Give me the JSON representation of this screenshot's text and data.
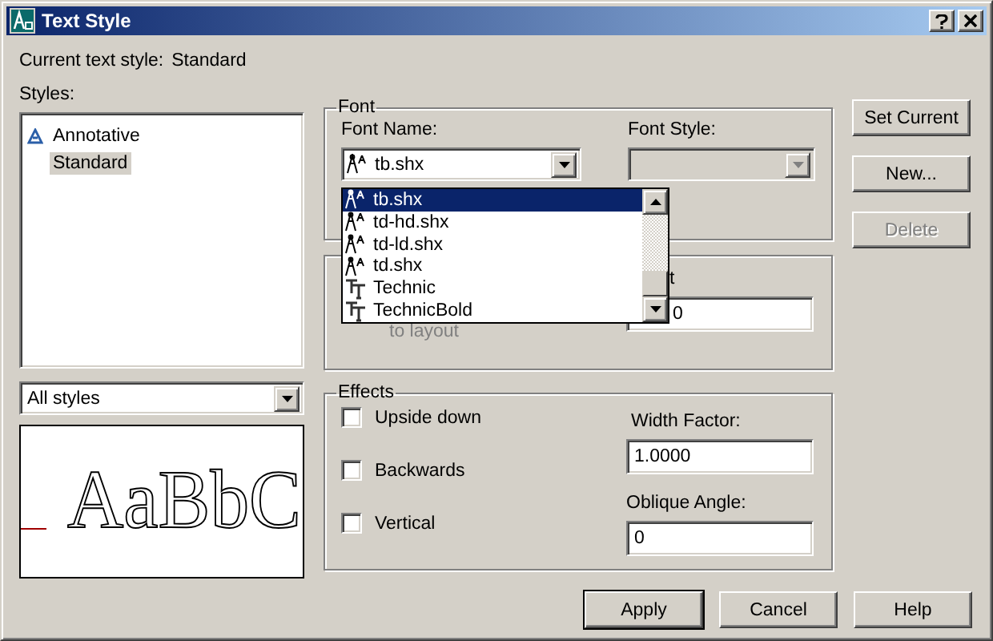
{
  "window": {
    "title": "Text Style"
  },
  "current_style": {
    "label": "Current text style:",
    "value": "Standard"
  },
  "styles": {
    "label": "Styles:",
    "items": [
      {
        "name": "Annotative",
        "annotative": true,
        "selected": false
      },
      {
        "name": "Standard",
        "annotative": false,
        "selected": true
      }
    ],
    "filter": "All styles"
  },
  "preview": {
    "sample": "AaBbC"
  },
  "font": {
    "legend": "Font",
    "font_name_label": "Font Name:",
    "font_name": "tb.shx",
    "font_style_label": "Font Style:",
    "font_style_disabled": true,
    "dropdown": [
      {
        "name": "tb.shx",
        "kind": "shx",
        "selected": true
      },
      {
        "name": "td-hd.shx",
        "kind": "shx",
        "selected": false
      },
      {
        "name": "td-ld.shx",
        "kind": "shx",
        "selected": false
      },
      {
        "name": "td.shx",
        "kind": "shx",
        "selected": false
      },
      {
        "name": "Technic",
        "kind": "truetype",
        "selected": false
      },
      {
        "name": "TechnicBold",
        "kind": "truetype",
        "selected": false
      }
    ]
  },
  "size": {
    "layout_text": "to layout",
    "height_label": "t",
    "height_value": "0"
  },
  "effects": {
    "legend": "Effects",
    "checkboxes": [
      {
        "label": "Upside down",
        "checked": false
      },
      {
        "label": "Backwards",
        "checked": false
      },
      {
        "label": "Vertical",
        "checked": false
      }
    ],
    "width_factor": {
      "label": "Width Factor:",
      "value": "1.0000"
    },
    "oblique_angle": {
      "label": "Oblique Angle:",
      "value": "0"
    }
  },
  "side_buttons": [
    {
      "label": "Set Current",
      "disabled": false
    },
    {
      "label": "New...",
      "disabled": false
    },
    {
      "label": "Delete",
      "disabled": true
    }
  ],
  "bottom_buttons": [
    {
      "label": "Apply",
      "default": true
    },
    {
      "label": "Cancel",
      "default": false
    },
    {
      "label": "Help",
      "default": false
    }
  ]
}
